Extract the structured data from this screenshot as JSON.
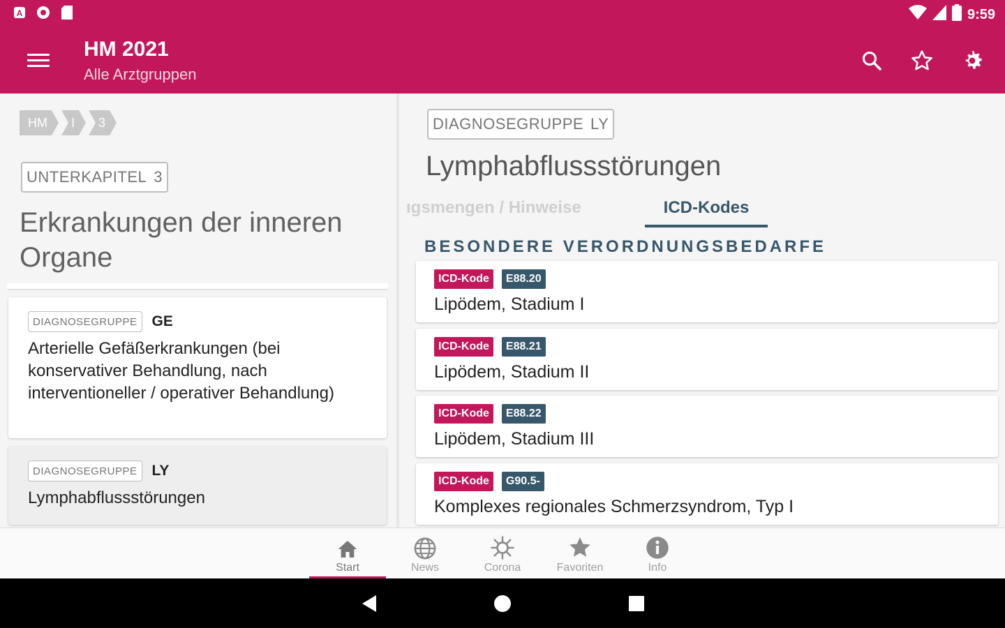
{
  "status_bar": {
    "time": "9:59"
  },
  "app_bar": {
    "title": "HM 2021",
    "subtitle": "Alle Arztgruppen",
    "actions": [
      "search-icon",
      "star-outline-icon",
      "gear-icon"
    ]
  },
  "left": {
    "breadcrumb": [
      "HM",
      "I",
      "3"
    ],
    "tag_label": "UNTERKAPITEL",
    "tag_value": "3",
    "title": "Erkrankungen der inneren Organe",
    "cards": [
      {
        "tag_label": "DIAGNOSEGRUPPE",
        "code": "GE",
        "text": "Arterielle Gefäßerkrankungen (bei konservativer Behandlung, nach interventioneller / operativer Behandlung)"
      },
      {
        "tag_label": "DIAGNOSEGRUPPE",
        "code": "LY",
        "text": "Lymphabflussstörungen"
      }
    ]
  },
  "right": {
    "tag_label": "DIAGNOSEGRUPPE",
    "tag_value": "LY",
    "title": "Lymphabflussstörungen",
    "tabs": [
      "ıgsmengen / Hinweise",
      "ICD-Kodes"
    ],
    "section_heading": "BESONDERE VERORDNUNGSBEDARFE",
    "items": [
      {
        "badge": "ICD-Kode",
        "code": "E88.20",
        "text": "Lipödem, Stadium I"
      },
      {
        "badge": "ICD-Kode",
        "code": "E88.21",
        "text": "Lipödem, Stadium II"
      },
      {
        "badge": "ICD-Kode",
        "code": "E88.22",
        "text": "Lipödem, Stadium III"
      },
      {
        "badge": "ICD-Kode",
        "code": "G90.5-",
        "text": "Komplexes regionales Schmerzsyndrom, Typ I"
      }
    ]
  },
  "bottom_nav": [
    {
      "label": "Start",
      "icon": "home-icon",
      "active": true
    },
    {
      "label": "News",
      "icon": "globe-icon",
      "active": false
    },
    {
      "label": "Corona",
      "icon": "virus-icon",
      "active": false
    },
    {
      "label": "Favoriten",
      "icon": "star-icon",
      "active": false
    },
    {
      "label": "Info",
      "icon": "info-icon",
      "active": false
    }
  ],
  "colors": {
    "primary": "#c2185b",
    "secondary": "#37576b"
  }
}
